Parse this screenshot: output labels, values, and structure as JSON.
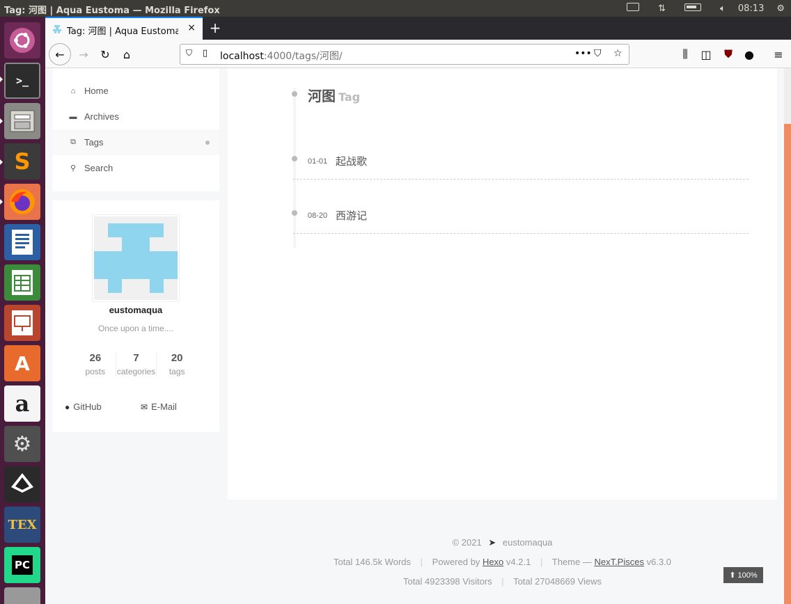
{
  "system": {
    "window_title": "Tag: 河图 | Aqua Eustoma — Mozilla Firefox",
    "clock": "08:13"
  },
  "launcher": {
    "apps": [
      "ubuntu-dash",
      "terminal",
      "files",
      "sublime-text",
      "firefox",
      "libreoffice-writer",
      "libreoffice-calc",
      "libreoffice-impress",
      "software-center",
      "amazon",
      "system-settings",
      "inkscape",
      "texstudio",
      "pycharm",
      "disk"
    ]
  },
  "browser": {
    "tab_title": "Tag: 河图 | Aqua Eustoma",
    "url_host": "localhost",
    "url_path": ":4000/tags/河图/",
    "new_tab": "+",
    "close_tab": "×"
  },
  "menu": {
    "items": [
      {
        "label": "Home",
        "icon": "home-icon"
      },
      {
        "label": "Archives",
        "icon": "archive-icon"
      },
      {
        "label": "Tags",
        "icon": "tags-icon"
      },
      {
        "label": "Search",
        "icon": "search-icon"
      }
    ]
  },
  "sidebar": {
    "author": "eustomaqua",
    "description": "Once upon a time....",
    "stats": [
      {
        "count": "26",
        "label": "posts"
      },
      {
        "count": "7",
        "label": "categories"
      },
      {
        "count": "20",
        "label": "tags"
      }
    ],
    "links": [
      {
        "label": "GitHub",
        "icon": "github-icon"
      },
      {
        "label": "E-Mail",
        "icon": "envelope-icon"
      }
    ]
  },
  "main": {
    "tag_name": "河图",
    "tag_suffix": "Tag",
    "posts": [
      {
        "date": "01-01",
        "title": "起战歌"
      },
      {
        "date": "08-20",
        "title": "西游记"
      }
    ]
  },
  "footer": {
    "copyright": "© 2021",
    "author": "eustomaqua",
    "words": "Total 146.5k Words",
    "powered_by": "Powered by",
    "hexo": "Hexo",
    "hexo_version": "v4.2.1",
    "theme_label": "Theme —",
    "theme": "NexT.Pisces",
    "theme_version": "v6.3.0",
    "visitors": "Total  4923398  Visitors",
    "views": "Total  27048669  Views",
    "back_to_top": "100%"
  },
  "colors": {
    "accent": "#ef8c64",
    "launcher": "#4a1c3c",
    "avatar": "#8fd5ee"
  }
}
